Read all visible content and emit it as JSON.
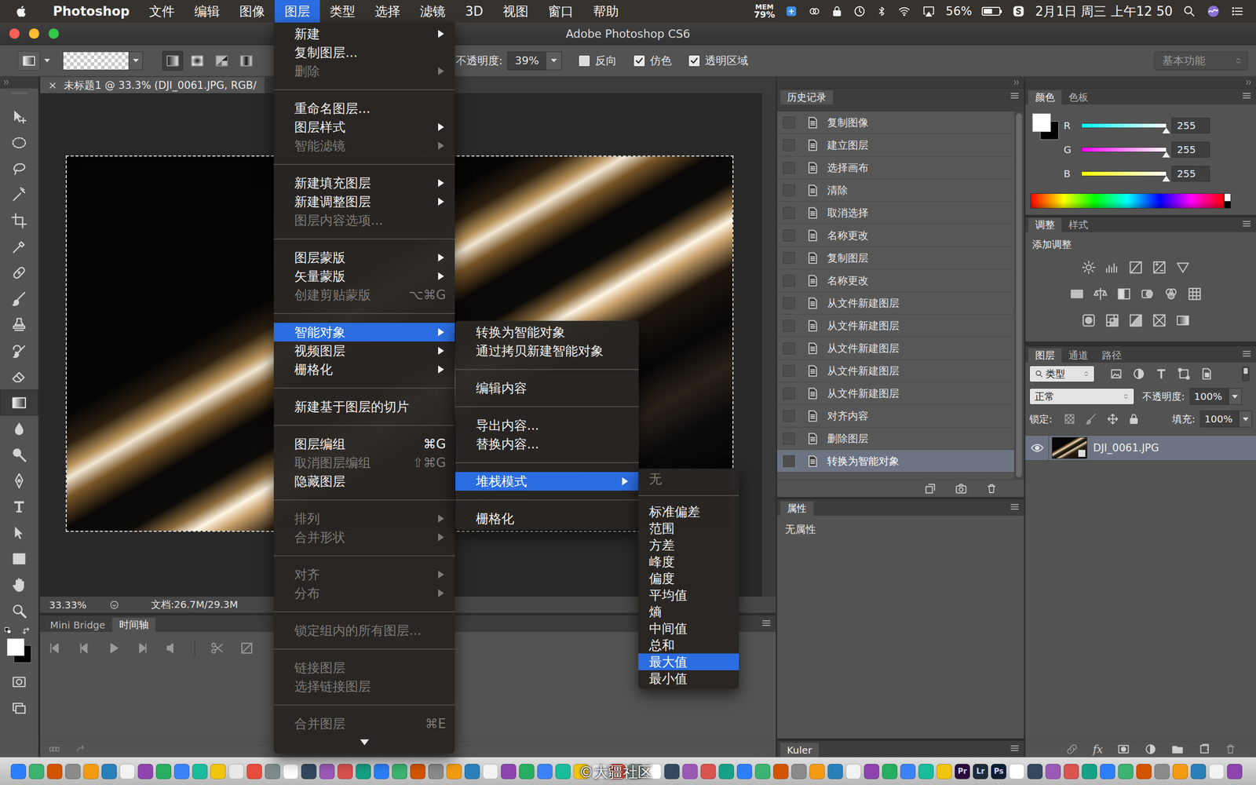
{
  "macbar": {
    "items": [
      {
        "label": "Photoshop",
        "kind": "app",
        "selected": false
      },
      {
        "label": "文件",
        "kind": "menu",
        "selected": false
      },
      {
        "label": "编辑",
        "kind": "menu",
        "selected": false
      },
      {
        "label": "图像",
        "kind": "menu",
        "selected": false
      },
      {
        "label": "图层",
        "kind": "menu",
        "selected": true
      },
      {
        "label": "类型",
        "kind": "menu",
        "selected": false
      },
      {
        "label": "选择",
        "kind": "menu",
        "selected": false
      },
      {
        "label": "滤镜",
        "kind": "menu",
        "selected": false
      },
      {
        "label": "3D",
        "kind": "menu",
        "selected": false
      },
      {
        "label": "视图",
        "kind": "menu",
        "selected": false
      },
      {
        "label": "窗口",
        "kind": "menu",
        "selected": false
      },
      {
        "label": "帮助",
        "kind": "menu",
        "selected": false
      }
    ],
    "mem_label": "MEM",
    "mem_value": "79%",
    "battery": "56%",
    "battery_level": 0.56,
    "clock": "2月1日 周三 上午12 50"
  },
  "window": {
    "title": "Adobe Photoshop CS6"
  },
  "options": {
    "modes": [
      {
        "kind": "linear",
        "selected": true
      },
      {
        "kind": "radial",
        "selected": false
      },
      {
        "kind": "angle",
        "selected": false
      },
      {
        "kind": "reflected",
        "selected": false
      }
    ],
    "opacity_label": "不透明度:",
    "opacity": "39%",
    "checkboxes": [
      {
        "label": "反向",
        "checked": false
      },
      {
        "label": "仿色",
        "checked": true
      },
      {
        "label": "透明区域",
        "checked": true
      }
    ],
    "workspace": "基本功能"
  },
  "toolbar": {
    "tools": [
      {
        "kind": "move",
        "selected": false
      },
      {
        "kind": "marquee",
        "selected": false
      },
      {
        "kind": "lasso",
        "selected": false
      },
      {
        "kind": "wand",
        "selected": false
      },
      {
        "kind": "crop",
        "selected": false
      },
      {
        "kind": "eyedropper",
        "selected": false
      },
      {
        "kind": "heal",
        "selected": false
      },
      {
        "kind": "brush",
        "selected": false
      },
      {
        "kind": "stamp",
        "selected": false
      },
      {
        "kind": "historybrush",
        "selected": false
      },
      {
        "kind": "eraser",
        "selected": false
      },
      {
        "kind": "gradient",
        "selected": true
      },
      {
        "kind": "blur",
        "selected": false
      },
      {
        "kind": "dodge",
        "selected": false
      },
      {
        "kind": "pen",
        "selected": false
      },
      {
        "kind": "type",
        "selected": false
      },
      {
        "kind": "pathselect",
        "selected": false
      },
      {
        "kind": "rectangle",
        "selected": false
      },
      {
        "kind": "hand",
        "selected": false
      },
      {
        "kind": "zoom",
        "selected": false
      }
    ]
  },
  "document": {
    "close": "×",
    "tab": "未标题1 @ 33.3% (DJI_0061.JPG, RGB/",
    "zoom": "33.33%",
    "info": "文档:26.7M/29.3M"
  },
  "timeline": {
    "tabs": [
      {
        "label": "Mini Bridge",
        "selected": false
      },
      {
        "label": "时间轴",
        "selected": true
      }
    ]
  },
  "history": {
    "tab": "历史记录",
    "items": [
      {
        "label": "复制图像",
        "selected": false
      },
      {
        "label": "建立图层",
        "selected": false
      },
      {
        "label": "选择画布",
        "selected": false
      },
      {
        "label": "清除",
        "selected": false
      },
      {
        "label": "取消选择",
        "selected": false
      },
      {
        "label": "名称更改",
        "selected": false
      },
      {
        "label": "复制图层",
        "selected": false
      },
      {
        "label": "名称更改",
        "selected": false
      },
      {
        "label": "从文件新建图层",
        "selected": false
      },
      {
        "label": "从文件新建图层",
        "selected": false
      },
      {
        "label": "从文件新建图层",
        "selected": false
      },
      {
        "label": "从文件新建图层",
        "selected": false
      },
      {
        "label": "从文件新建图层",
        "selected": false
      },
      {
        "label": "对齐内容",
        "selected": false
      },
      {
        "label": "删除图层",
        "selected": false
      },
      {
        "label": "转换为智能对象",
        "selected": true
      }
    ]
  },
  "properties": {
    "tab": "属性",
    "empty": "无属性"
  },
  "kuler": {
    "tab": "Kuler"
  },
  "color": {
    "tabs": [
      {
        "label": "颜色",
        "selected": true
      },
      {
        "label": "色板",
        "selected": false
      }
    ],
    "channels": [
      {
        "name": "R",
        "value": "255",
        "level": 1,
        "color": "#00ffff"
      },
      {
        "name": "G",
        "value": "255",
        "level": 1,
        "color": "#ff00ff"
      },
      {
        "name": "B",
        "value": "255",
        "level": 1,
        "color": "#ffff00"
      }
    ]
  },
  "adjustments": {
    "tabs": [
      {
        "label": "调整",
        "selected": true
      },
      {
        "label": "样式",
        "selected": false
      }
    ],
    "title": "添加调整"
  },
  "layers": {
    "tabs": [
      {
        "label": "图层",
        "selected": true
      },
      {
        "label": "通道",
        "selected": false
      },
      {
        "label": "路径",
        "selected": false
      }
    ],
    "filter": "类型",
    "blend": "正常",
    "opacity_label": "不透明度:",
    "opacity": "100%",
    "lock_label": "锁定:",
    "fill_label": "填充:",
    "fill": "100%",
    "items": [
      {
        "name": "DJI_0061.JPG",
        "selected": true,
        "visible": true
      }
    ],
    "fx": "fx"
  },
  "layer_menu": {
    "items": [
      {
        "kind": "item",
        "label": "新建",
        "submenu": true,
        "disabled": false,
        "selected": false,
        "shortcut": ""
      },
      {
        "kind": "item",
        "label": "复制图层...",
        "submenu": false,
        "disabled": false,
        "selected": false,
        "shortcut": ""
      },
      {
        "kind": "item",
        "label": "删除",
        "submenu": true,
        "disabled": true,
        "selected": false,
        "shortcut": ""
      },
      {
        "kind": "separator"
      },
      {
        "kind": "item",
        "label": "重命名图层...",
        "submenu": false,
        "disabled": false,
        "selected": false,
        "shortcut": ""
      },
      {
        "kind": "item",
        "label": "图层样式",
        "submenu": true,
        "disabled": false,
        "selected": false,
        "shortcut": ""
      },
      {
        "kind": "item",
        "label": "智能滤镜",
        "submenu": true,
        "disabled": true,
        "selected": false,
        "shortcut": ""
      },
      {
        "kind": "separator"
      },
      {
        "kind": "item",
        "label": "新建填充图层",
        "submenu": true,
        "disabled": false,
        "selected": false,
        "shortcut": ""
      },
      {
        "kind": "item",
        "label": "新建调整图层",
        "submenu": true,
        "disabled": false,
        "selected": false,
        "shortcut": ""
      },
      {
        "kind": "item",
        "label": "图层内容选项...",
        "submenu": false,
        "disabled": true,
        "selected": false,
        "shortcut": ""
      },
      {
        "kind": "separator"
      },
      {
        "kind": "item",
        "label": "图层蒙版",
        "submenu": true,
        "disabled": false,
        "selected": false,
        "shortcut": ""
      },
      {
        "kind": "item",
        "label": "矢量蒙版",
        "submenu": true,
        "disabled": false,
        "selected": false,
        "shortcut": ""
      },
      {
        "kind": "item",
        "label": "创建剪贴蒙版",
        "submenu": false,
        "disabled": true,
        "selected": false,
        "shortcut": "⌥⌘G"
      },
      {
        "kind": "separator"
      },
      {
        "kind": "item",
        "label": "智能对象",
        "submenu": true,
        "disabled": false,
        "selected": true,
        "shortcut": ""
      },
      {
        "kind": "item",
        "label": "视频图层",
        "submenu": true,
        "disabled": false,
        "selected": false,
        "shortcut": ""
      },
      {
        "kind": "item",
        "label": "栅格化",
        "submenu": true,
        "disabled": false,
        "selected": false,
        "shortcut": ""
      },
      {
        "kind": "separator"
      },
      {
        "kind": "item",
        "label": "新建基于图层的切片",
        "submenu": false,
        "disabled": false,
        "selected": false,
        "shortcut": ""
      },
      {
        "kind": "separator"
      },
      {
        "kind": "item",
        "label": "图层编组",
        "submenu": false,
        "disabled": false,
        "selected": false,
        "shortcut": "⌘G"
      },
      {
        "kind": "item",
        "label": "取消图层编组",
        "submenu": false,
        "disabled": true,
        "selected": false,
        "shortcut": "⇧⌘G"
      },
      {
        "kind": "item",
        "label": "隐藏图层",
        "submenu": false,
        "disabled": false,
        "selected": false,
        "shortcut": ""
      },
      {
        "kind": "separator"
      },
      {
        "kind": "item",
        "label": "排列",
        "submenu": true,
        "disabled": true,
        "selected": false,
        "shortcut": ""
      },
      {
        "kind": "item",
        "label": "合并形状",
        "submenu": true,
        "disabled": true,
        "selected": false,
        "shortcut": ""
      },
      {
        "kind": "separator"
      },
      {
        "kind": "item",
        "label": "对齐",
        "submenu": true,
        "disabled": true,
        "selected": false,
        "shortcut": ""
      },
      {
        "kind": "item",
        "label": "分布",
        "submenu": true,
        "disabled": true,
        "selected": false,
        "shortcut": ""
      },
      {
        "kind": "separator"
      },
      {
        "kind": "item",
        "label": "锁定组内的所有图层...",
        "submenu": false,
        "disabled": true,
        "selected": false,
        "shortcut": ""
      },
      {
        "kind": "separator"
      },
      {
        "kind": "item",
        "label": "链接图层",
        "submenu": false,
        "disabled": true,
        "selected": false,
        "shortcut": ""
      },
      {
        "kind": "item",
        "label": "选择链接图层",
        "submenu": false,
        "disabled": true,
        "selected": false,
        "shortcut": ""
      },
      {
        "kind": "separator"
      },
      {
        "kind": "item",
        "label": "合并图层",
        "submenu": false,
        "disabled": true,
        "selected": false,
        "shortcut": "⌘E"
      }
    ]
  },
  "smart_object_menu": {
    "items": [
      {
        "kind": "item",
        "label": "转换为智能对象",
        "submenu": false,
        "disabled": false,
        "selected": false,
        "shortcut": ""
      },
      {
        "kind": "item",
        "label": "通过拷贝新建智能对象",
        "submenu": false,
        "disabled": false,
        "selected": false,
        "shortcut": ""
      },
      {
        "kind": "separator"
      },
      {
        "kind": "item",
        "label": "编辑内容",
        "submenu": false,
        "disabled": false,
        "selected": false,
        "shortcut": ""
      },
      {
        "kind": "separator"
      },
      {
        "kind": "item",
        "label": "导出内容...",
        "submenu": false,
        "disabled": false,
        "selected": false,
        "shortcut": ""
      },
      {
        "kind": "item",
        "label": "替换内容...",
        "submenu": false,
        "disabled": false,
        "selected": false,
        "shortcut": ""
      },
      {
        "kind": "separator"
      },
      {
        "kind": "item",
        "label": "堆栈模式",
        "submenu": true,
        "disabled": false,
        "selected": true,
        "shortcut": ""
      },
      {
        "kind": "separator"
      },
      {
        "kind": "item",
        "label": "栅格化",
        "submenu": false,
        "disabled": false,
        "selected": false,
        "shortcut": ""
      }
    ]
  },
  "stack_mode_menu": {
    "items": [
      {
        "kind": "item",
        "label": "无",
        "submenu": false,
        "disabled": true,
        "selected": false,
        "shortcut": ""
      },
      {
        "kind": "separator"
      },
      {
        "kind": "item",
        "label": "标准偏差",
        "submenu": false,
        "disabled": false,
        "selected": false,
        "shortcut": ""
      },
      {
        "kind": "item",
        "label": "范围",
        "submenu": false,
        "disabled": false,
        "selected": false,
        "shortcut": ""
      },
      {
        "kind": "item",
        "label": "方差",
        "submenu": false,
        "disabled": false,
        "selected": false,
        "shortcut": ""
      },
      {
        "kind": "item",
        "label": "峰度",
        "submenu": false,
        "disabled": false,
        "selected": false,
        "shortcut": ""
      },
      {
        "kind": "item",
        "label": "偏度",
        "submenu": false,
        "disabled": false,
        "selected": false,
        "shortcut": ""
      },
      {
        "kind": "item",
        "label": "平均值",
        "submenu": false,
        "disabled": false,
        "selected": false,
        "shortcut": ""
      },
      {
        "kind": "item",
        "label": "熵",
        "submenu": false,
        "disabled": false,
        "selected": false,
        "shortcut": ""
      },
      {
        "kind": "item",
        "label": "中间值",
        "submenu": false,
        "disabled": false,
        "selected": false,
        "shortcut": ""
      },
      {
        "kind": "item",
        "label": "总和",
        "submenu": false,
        "disabled": false,
        "selected": false,
        "shortcut": ""
      },
      {
        "kind": "item",
        "label": "最大值",
        "submenu": false,
        "disabled": false,
        "selected": true,
        "shortcut": ""
      },
      {
        "kind": "item",
        "label": "最小值",
        "submenu": false,
        "disabled": false,
        "selected": false,
        "shortcut": ""
      }
    ]
  },
  "dock": {
    "labeled": [
      {
        "label": "Pr",
        "color": "#2b0a3d"
      },
      {
        "label": "Lr",
        "color": "#1c2b3a"
      },
      {
        "label": "Ps",
        "color": "#0b1d33"
      }
    ]
  },
  "watermark": "©大疆社区"
}
